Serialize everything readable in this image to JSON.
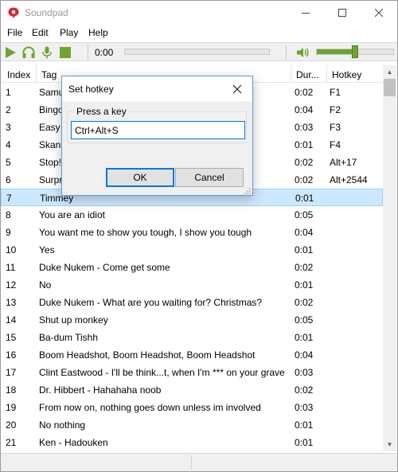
{
  "window": {
    "title": "Soundpad"
  },
  "menu": [
    {
      "label": "File"
    },
    {
      "label": "Edit"
    },
    {
      "label": "Play"
    },
    {
      "label": "Help"
    }
  ],
  "toolbar": {
    "time": "0:00",
    "volume_level": 0.5
  },
  "columns": {
    "index": "Index",
    "tag": "Tag",
    "duration": "Dur...",
    "hotkey": "Hotkey"
  },
  "rows": [
    {
      "index": "1",
      "tag": "Samu",
      "duration": "0:02",
      "hotkey": "F1"
    },
    {
      "index": "2",
      "tag": "Bingo",
      "duration": "0:04",
      "hotkey": "F2"
    },
    {
      "index": "3",
      "tag": "Easy p",
      "duration": "0:03",
      "hotkey": "F3"
    },
    {
      "index": "4",
      "tag": "Skand",
      "duration": "0:01",
      "hotkey": "F4"
    },
    {
      "index": "5",
      "tag": "Stop!",
      "duration": "0:02",
      "hotkey": "Alt+17"
    },
    {
      "index": "6",
      "tag": "Surpr",
      "duration": "0:02",
      "hotkey": "Alt+2544"
    },
    {
      "index": "7",
      "tag": "Timmey",
      "duration": "0:01",
      "hotkey": "",
      "selected": true
    },
    {
      "index": "8",
      "tag": "You are an idiot",
      "duration": "0:05",
      "hotkey": ""
    },
    {
      "index": "9",
      "tag": "You want me to show you tough, I show you tough",
      "duration": "0:04",
      "hotkey": ""
    },
    {
      "index": "10",
      "tag": "Yes",
      "duration": "0:01",
      "hotkey": ""
    },
    {
      "index": "11",
      "tag": "Duke Nukem - Come get some",
      "duration": "0:02",
      "hotkey": ""
    },
    {
      "index": "12",
      "tag": "No",
      "duration": "0:01",
      "hotkey": ""
    },
    {
      "index": "13",
      "tag": "Duke Nukem - What are you waiting for? Christmas?",
      "duration": "0:02",
      "hotkey": ""
    },
    {
      "index": "14",
      "tag": "Shut up monkey",
      "duration": "0:05",
      "hotkey": ""
    },
    {
      "index": "15",
      "tag": "Ba-dum Tishh",
      "duration": "0:01",
      "hotkey": ""
    },
    {
      "index": "16",
      "tag": "Boom Headshot, Boom Headshot, Boom Headshot",
      "duration": "0:04",
      "hotkey": ""
    },
    {
      "index": "17",
      "tag": "Clint Eastwood - I'll be think...t, when I'm *** on your grave",
      "duration": "0:03",
      "hotkey": ""
    },
    {
      "index": "18",
      "tag": "Dr. Hibbert - Hahahaha noob",
      "duration": "0:02",
      "hotkey": ""
    },
    {
      "index": "19",
      "tag": "From now on, nothing goes down unless im involved",
      "duration": "0:03",
      "hotkey": ""
    },
    {
      "index": "20",
      "tag": "No nothing",
      "duration": "0:01",
      "hotkey": ""
    },
    {
      "index": "21",
      "tag": "Ken - Hadouken",
      "duration": "0:01",
      "hotkey": ""
    }
  ],
  "dialog": {
    "title": "Set hotkey",
    "group_label": "Press a key",
    "input_value": "Ctrl+Alt+S",
    "ok_label": "OK",
    "cancel_label": "Cancel"
  },
  "colors": {
    "accent_green": "#6ea42f",
    "selection": "#cce8ff",
    "focus_blue": "#0078d7"
  }
}
